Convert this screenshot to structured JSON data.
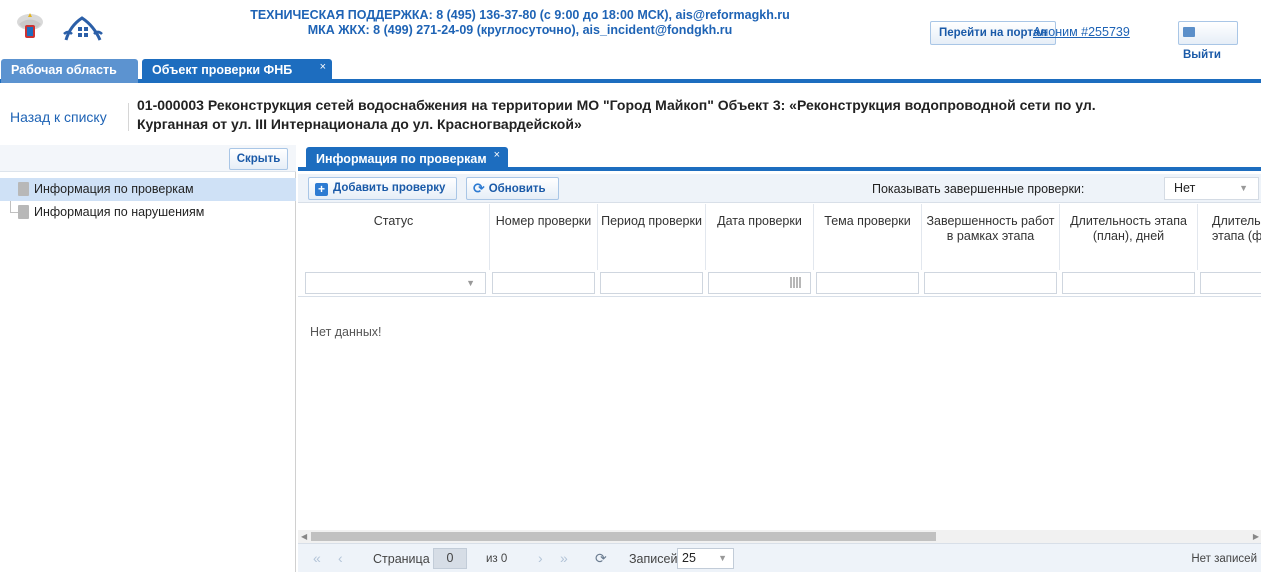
{
  "header": {
    "support_line1": "ТЕХНИЧЕСКАЯ ПОДДЕРЖКА: 8 (495) 136-37-80 (с 9:00 до 18:00 МСК), ais@reformagkh.ru",
    "support_line2": "МКА ЖКХ: 8 (499) 271-24-09 (круглосуточно), ais_incident@fondgkh.ru",
    "portal_button": "Перейти на портал",
    "user_link": "Аноним #255739",
    "logout_button": "Выйти"
  },
  "top_tabs": [
    {
      "label": "Рабочая область",
      "active": false
    },
    {
      "label": "Объект проверки ФНБ",
      "active": true,
      "close": "×"
    }
  ],
  "object": {
    "back_link": "Назад к списку",
    "title_line1": "01-000003 Реконструкция сетей водоснабжения на территории МО \"Город Майкоп\" Объект 3: «Реконструкция водопроводной сети по ул.",
    "title_line2": "Курганная от ул. III Интернационала до ул. Красногвардейской»"
  },
  "left_panel": {
    "hide_button": "Скрыть",
    "tree": [
      {
        "label": "Информация по проверкам",
        "selected": true
      },
      {
        "label": "Информация по нарушениям",
        "selected": false
      }
    ]
  },
  "right_panel": {
    "tab": {
      "label": "Информация по проверкам",
      "close": "×"
    },
    "toolbar": {
      "add_button": "Добавить проверку",
      "refresh_button": "Обновить",
      "show_done_label": "Показывать завершенные проверки:",
      "show_done_value": "Нет"
    },
    "columns": [
      "Статус",
      "Номер проверки",
      "Период проверки",
      "Дата проверки",
      "Тема проверки",
      "Завершенность работ в рамках этапа",
      "Длительность этапа (план), дней",
      "Длительность этапа (ф"
    ],
    "empty_text": "Нет данных!",
    "pager": {
      "page_label": "Страница",
      "page_value": "0",
      "of_label": "из 0",
      "records_label": "Записей:",
      "records_value": "25",
      "no_records": "Нет записей"
    }
  },
  "colors": {
    "accent": "#1d6dbf",
    "inactive_tab": "#5c93d0",
    "link": "#1e63b5",
    "selected_row": "#cfe1f6"
  }
}
